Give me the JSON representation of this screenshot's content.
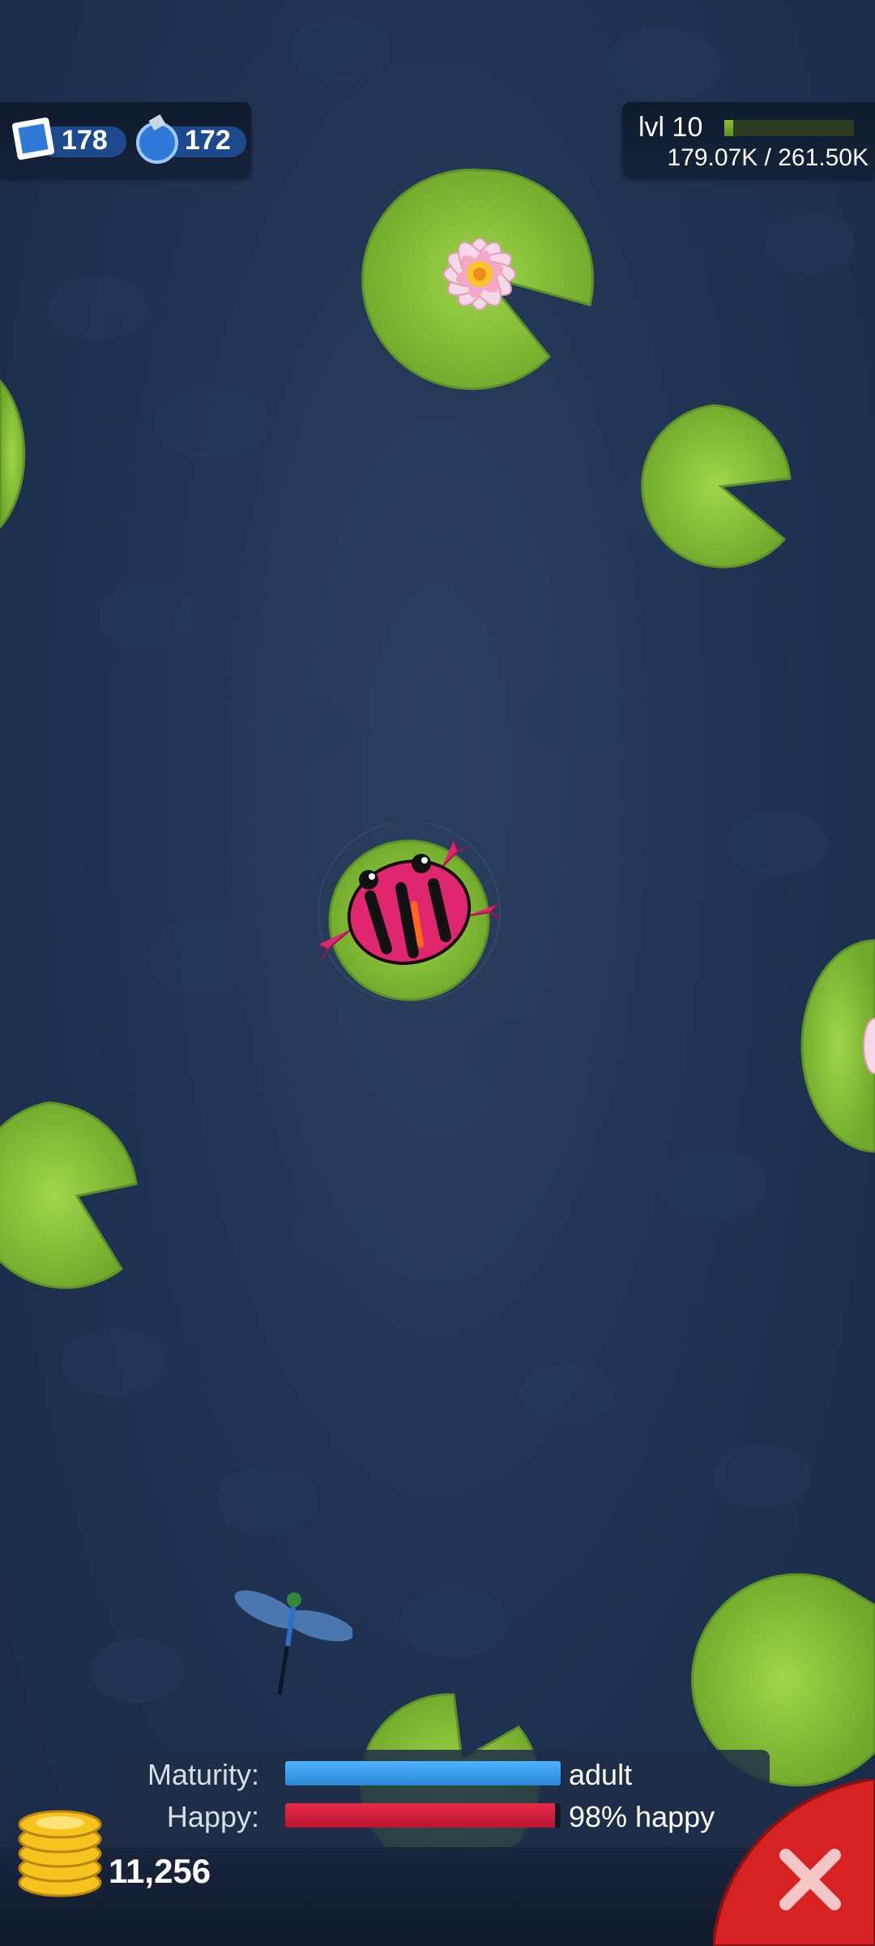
{
  "hud": {
    "stamps": "178",
    "potions": "172",
    "level_label": "lvl 10",
    "xp_text": "179.07K / 261.50K",
    "xp_fraction": 0.07
  },
  "status": {
    "maturity_label": "Maturity:",
    "maturity_value": "adult",
    "maturity_fraction": 1.0,
    "happy_label": "Happy:",
    "happy_value": "98% happy",
    "happy_fraction": 0.98
  },
  "coins": "11,256",
  "icons": {
    "stamp": "stamp-icon",
    "potion": "potion-icon",
    "coin": "coin-stack-icon",
    "close": "close-icon"
  },
  "colors": {
    "maturity_bar": "#4fb3ff",
    "happy_bar": "#e8294a",
    "lily_pad": "#8cc63f",
    "frog": "#e0266f",
    "close_button": "#d62222"
  }
}
